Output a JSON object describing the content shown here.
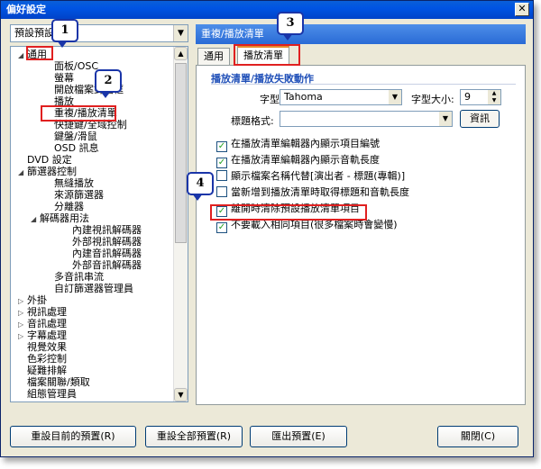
{
  "window": {
    "title": "偏好設定",
    "close_label": "✕"
  },
  "left_combo": {
    "value": "預設預設"
  },
  "tree": [
    {
      "label": "通用",
      "toggle": "◢"
    },
    {
      "label": "面板/OSC",
      "toggle": ""
    },
    {
      "label": "螢幕",
      "toggle": ""
    },
    {
      "label": "開啟檔案對話框",
      "toggle": ""
    },
    {
      "label": "播放",
      "toggle": ""
    },
    {
      "label": "重複/播放清單",
      "toggle": ""
    },
    {
      "label": "快捷鍵/全域控制",
      "toggle": ""
    },
    {
      "label": "鍵盤/滑鼠",
      "toggle": ""
    },
    {
      "label": "OSD 訊息",
      "toggle": ""
    },
    {
      "label": "DVD 設定",
      "toggle": ""
    },
    {
      "label": "篩選器控制",
      "toggle": "◢"
    },
    {
      "label": "無縫播放",
      "toggle": ""
    },
    {
      "label": "來源篩選器",
      "toggle": ""
    },
    {
      "label": "分離器",
      "toggle": ""
    },
    {
      "label": "解碼器用法",
      "toggle": "◢"
    },
    {
      "label": "內建視訊解碼器",
      "toggle": ""
    },
    {
      "label": "外部視訊解碼器",
      "toggle": ""
    },
    {
      "label": "內建音訊解碼器",
      "toggle": ""
    },
    {
      "label": "外部音訊解碼器",
      "toggle": ""
    },
    {
      "label": "多音訊串流",
      "toggle": ""
    },
    {
      "label": "自訂篩選器管理員",
      "toggle": ""
    },
    {
      "label": "外掛",
      "toggle": "▷"
    },
    {
      "label": "視訊處理",
      "toggle": "▷"
    },
    {
      "label": "音訊處理",
      "toggle": "▷"
    },
    {
      "label": "字幕處理",
      "toggle": "▷"
    },
    {
      "label": "視覺效果",
      "toggle": ""
    },
    {
      "label": "色彩控制",
      "toggle": ""
    },
    {
      "label": "疑難排解",
      "toggle": ""
    },
    {
      "label": "檔案關聯/類取",
      "toggle": ""
    },
    {
      "label": "組態管理員",
      "toggle": ""
    }
  ],
  "right_panel": {
    "header": "重複/播放清單",
    "tabs": [
      "通用",
      "播放清單"
    ],
    "group_title": "播放清單/播放失敗動作",
    "font_label": "字型:",
    "font_value": "Tahoma",
    "size_label": "字型大小:",
    "size_value": "9",
    "title_format_label": "標題格式:",
    "title_format_value": "",
    "info_button": "資訊",
    "options": [
      {
        "label": "在播放清單編輯器內顯示項目編號",
        "checked": true
      },
      {
        "label": "在播放清單編輯器內顯示音軌長度",
        "checked": true
      },
      {
        "label": "顯示檔案名稱代替[演出者 - 標題(專輯)]",
        "checked": false
      },
      {
        "label": "當新增到播放清單時取得標題和音軌長度",
        "checked": false
      },
      {
        "label": "離開時清除預設播放清單項目",
        "checked": true
      },
      {
        "label": "不要載入相同項目(很多檔案時會變慢)",
        "checked": true
      }
    ]
  },
  "footer": {
    "reset_current": "重設目前的預置(R)",
    "reset_all": "重設全部預置(R)",
    "export": "匯出預置(E)",
    "close": "關閉(C)"
  },
  "callouts": [
    "1",
    "2",
    "3",
    "4"
  ]
}
